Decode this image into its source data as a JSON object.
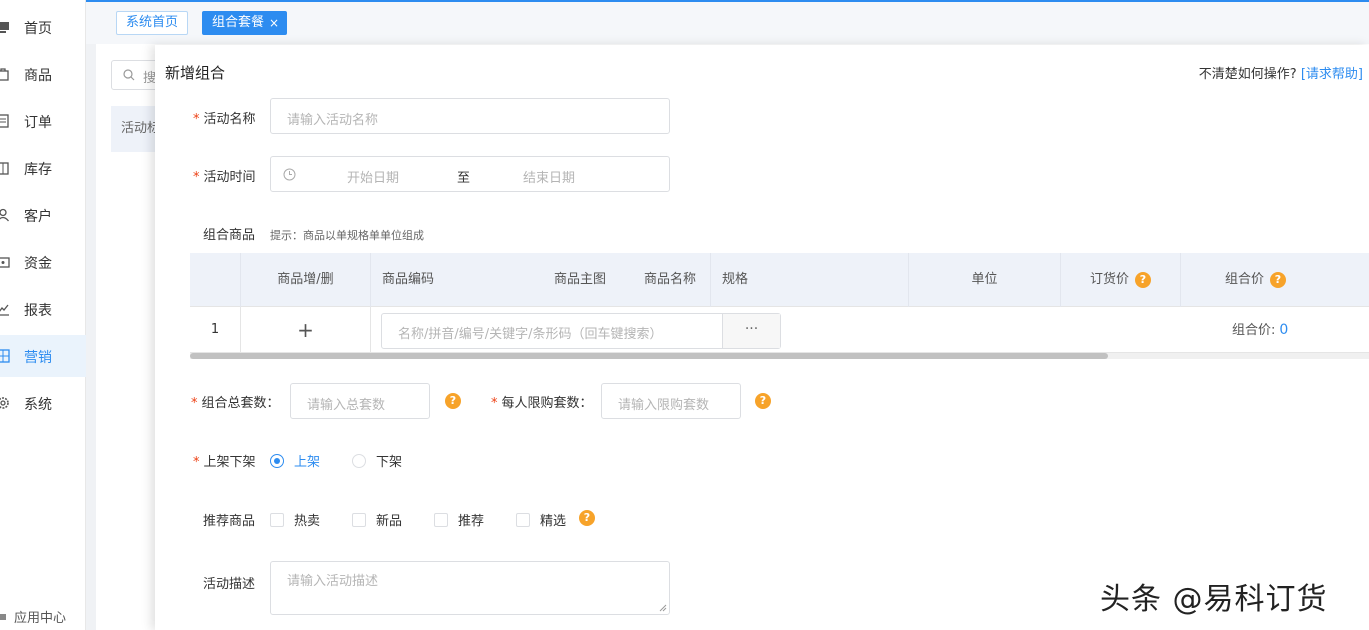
{
  "sidebar": {
    "items": [
      {
        "label": "首页",
        "icon": "monitor-icon"
      },
      {
        "label": "商品",
        "icon": "bag-icon"
      },
      {
        "label": "订单",
        "icon": "document-icon"
      },
      {
        "label": "库存",
        "icon": "inventory-icon"
      },
      {
        "label": "客户",
        "icon": "user-icon"
      },
      {
        "label": "资金",
        "icon": "wallet-icon"
      },
      {
        "label": "报表",
        "icon": "chart-icon"
      },
      {
        "label": "营销",
        "icon": "grid-icon",
        "active": true
      },
      {
        "label": "系统",
        "icon": "gear-icon"
      }
    ],
    "app_center": "应用中心"
  },
  "tabs": {
    "home": "系统首页",
    "active": "组合套餐",
    "close": "×"
  },
  "background": {
    "search_placeholder": "搜",
    "column_header": "活动标"
  },
  "drawer": {
    "title": "新增组合",
    "help_text": "不清楚如何操作?",
    "help_link": "[请求帮助]",
    "activity_name": {
      "label": "活动名称",
      "placeholder": "请输入活动名称"
    },
    "activity_time": {
      "label": "活动时间",
      "start": "开始日期",
      "separator": "至",
      "end": "结束日期"
    },
    "combo_goods": {
      "label": "组合商品",
      "hint": "提示：商品以单规格单单位组成"
    },
    "table": {
      "headers": [
        "商品增/删",
        "商品编码",
        "商品主图",
        "商品名称",
        "规格",
        "单位",
        "订货价",
        "组合价"
      ],
      "row": {
        "index": "1",
        "add": "+",
        "search_placeholder": "名称/拼音/编号/关键字/条形码（回车键搜索）",
        "more": "···",
        "combo_price_label": "组合价:",
        "combo_price_value": "0"
      }
    },
    "total_sets": {
      "label": "组合总套数：",
      "placeholder": "请输入总套数"
    },
    "limit_sets": {
      "label": "每人限购套数：",
      "placeholder": "请输入限购套数"
    },
    "shelf": {
      "label": "上架下架",
      "options": [
        "上架",
        "下架"
      ],
      "selected": "上架"
    },
    "recommend": {
      "label": "推荐商品",
      "options": [
        "热卖",
        "新品",
        "推荐",
        "精选"
      ]
    },
    "description": {
      "label": "活动描述",
      "placeholder": "请输入活动描述"
    },
    "qmark": "?"
  },
  "watermark": "头条 @易科订货",
  "colors": {
    "accent": "#2d8cf0",
    "required": "#ed4014",
    "help_badge": "#f7a32a"
  }
}
